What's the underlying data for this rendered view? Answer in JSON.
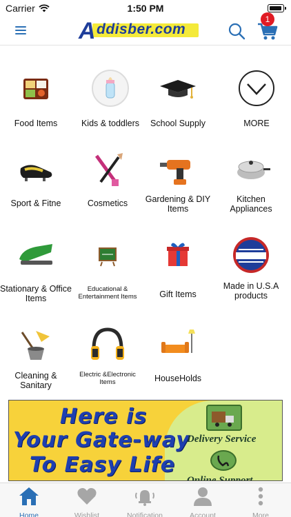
{
  "status_bar": {
    "carrier": "Carrier",
    "time": "1:50 PM"
  },
  "header": {
    "logo_text": "ddisber.com",
    "logo_initial": "A",
    "cart_count": "1",
    "accent": "#2a6fb5"
  },
  "categories": [
    {
      "label": "Food Items",
      "icon": "bento-box-icon"
    },
    {
      "label": "Kids & toddlers",
      "icon": "baby-bottle-icon"
    },
    {
      "label": "School Supply",
      "icon": "graduation-cap-icon"
    },
    {
      "label": "MORE",
      "icon": "chevron-down-icon"
    },
    {
      "label": "Sport & Fitne",
      "icon": "football-boot-icon"
    },
    {
      "label": "Cosmetics",
      "icon": "makeup-brush-icon"
    },
    {
      "label": "Gardening & DIY Items",
      "icon": "power-drill-icon"
    },
    {
      "label": "Kitchen Appliances",
      "icon": "cooking-pot-icon"
    },
    {
      "label": "Stationary & Office Items",
      "icon": "stapler-icon"
    },
    {
      "label": "Educational & Entertainment Items",
      "icon": "chalkboard-icon"
    },
    {
      "label": "Gift Items",
      "icon": "gift-box-icon"
    },
    {
      "label": "Made in U.S.A products",
      "icon": "made-in-usa-badge-icon"
    },
    {
      "label": "Cleaning & Sanitary",
      "icon": "mop-bucket-icon"
    },
    {
      "label": "Electric &Electronic Items",
      "icon": "headphones-icon"
    },
    {
      "label": "HouseHolds",
      "icon": "sofa-lamp-icon"
    }
  ],
  "banner": {
    "line1": "Here is",
    "line2": "Your Gate-way",
    "line3": "To Easy Life",
    "delivery": "Delivery Service",
    "support": "Online Support"
  },
  "tabs": [
    {
      "label": "Home"
    },
    {
      "label": "Wishlist"
    },
    {
      "label": "Notification"
    },
    {
      "label": "Account"
    },
    {
      "label": "More"
    }
  ]
}
